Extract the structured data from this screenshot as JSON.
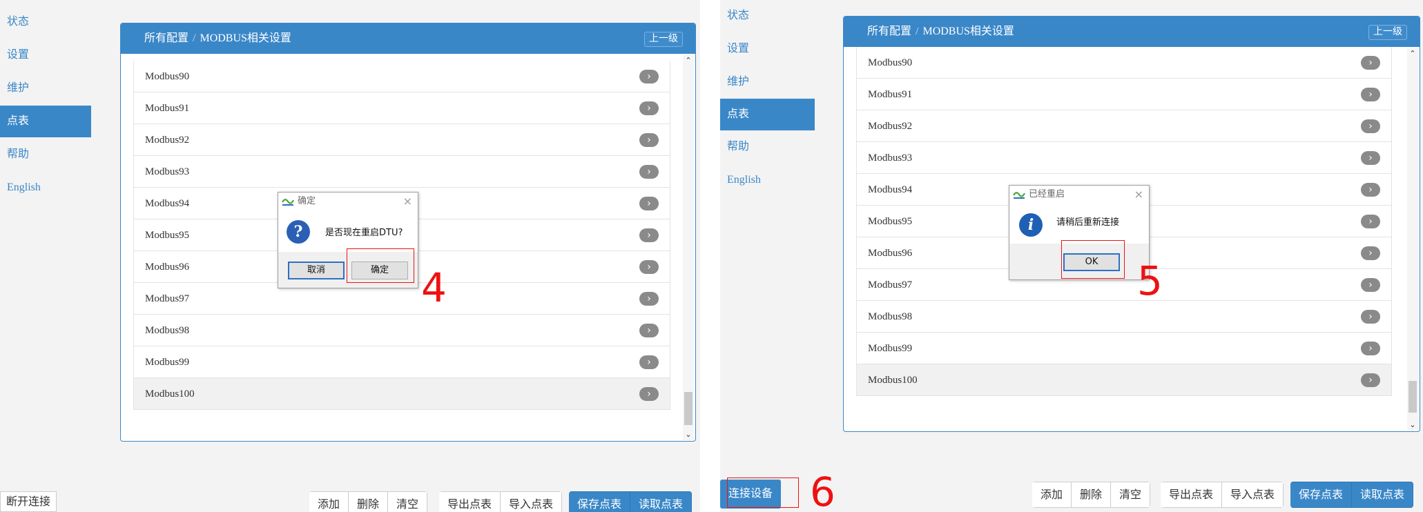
{
  "left": {
    "nav": [
      "状态",
      "设置",
      "维护",
      "点表",
      "帮助",
      "English"
    ],
    "active_nav": "点表",
    "breadcrumb": [
      "所有配置",
      "MODBUS相关设置"
    ],
    "up_button": "上一级",
    "rows": [
      "Modbus90",
      "Modbus91",
      "Modbus92",
      "Modbus93",
      "Modbus94",
      "Modbus95",
      "Modbus96",
      "Modbus97",
      "Modbus98",
      "Modbus99",
      "Modbus100"
    ],
    "dialog": {
      "title": "确定",
      "message": "是否现在重启DTU?",
      "cancel": "取消",
      "ok": "确定",
      "icon": "question-icon"
    },
    "step_number": "4",
    "disconnect": "断开连接",
    "toolbar": {
      "add": "添加",
      "delete": "删除",
      "clear": "清空",
      "export": "导出点表",
      "import": "导入点表",
      "save": "保存点表",
      "read": "读取点表"
    }
  },
  "right": {
    "nav": [
      "状态",
      "设置",
      "维护",
      "点表",
      "帮助",
      "English"
    ],
    "active_nav": "点表",
    "breadcrumb": [
      "所有配置",
      "MODBUS相关设置"
    ],
    "up_button": "上一级",
    "rows": [
      "Modbus90",
      "Modbus91",
      "Modbus92",
      "Modbus93",
      "Modbus94",
      "Modbus95",
      "Modbus96",
      "Modbus97",
      "Modbus98",
      "Modbus99",
      "Modbus100"
    ],
    "dialog": {
      "title": "已经重启",
      "message": "请稍后重新连接",
      "ok": "OK",
      "icon": "info-icon"
    },
    "step_numbers": [
      "5",
      "6"
    ],
    "connect": "连接设备",
    "toolbar": {
      "add": "添加",
      "delete": "删除",
      "clear": "清空",
      "export": "导出点表",
      "import": "导入点表",
      "save": "保存点表",
      "read": "读取点表"
    }
  },
  "colors": {
    "accent": "#3a87c8",
    "annotation": "#ee1111",
    "sidebar_bg": "#f3f3f3"
  }
}
